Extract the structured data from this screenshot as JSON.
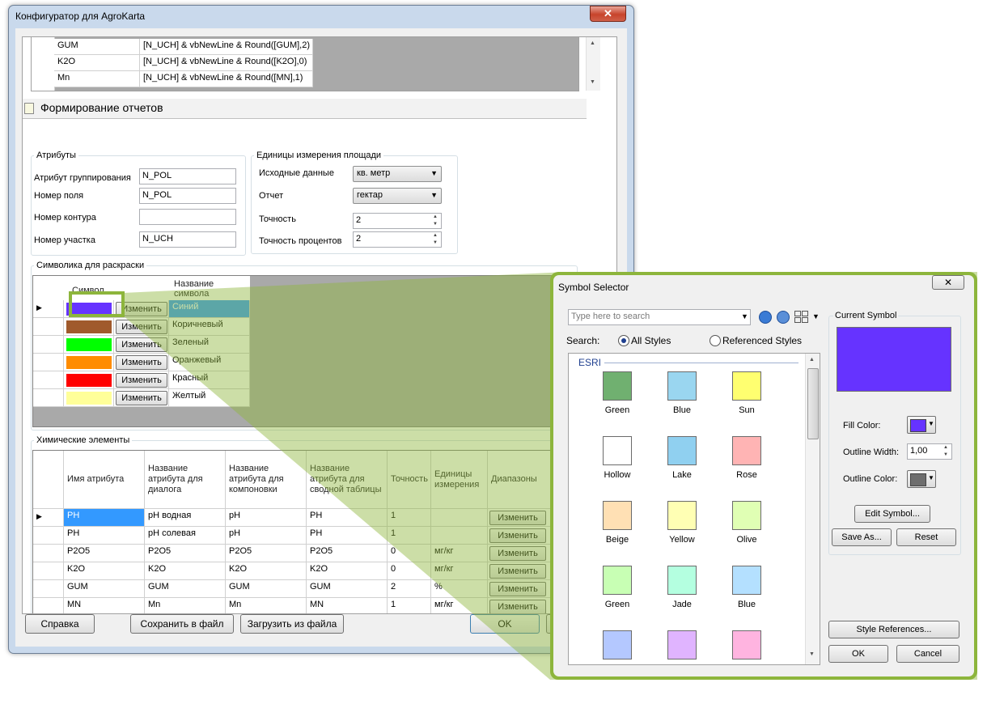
{
  "main_window": {
    "title": "Конфигуратор для AgroKarta",
    "close_glyph": "✕",
    "top_table": [
      {
        "name": "GUM",
        "expr": "[N_UCH] &  vbNewLine  &  Round([GUM],2)"
      },
      {
        "name": "K2O",
        "expr": "[N_UCH] &  vbNewLine  &  Round([K2O],0)"
      },
      {
        "name": "Mn",
        "expr": "[N_UCH] &  vbNewLine  &  Round([MN],1)"
      }
    ],
    "section_title": "Формирование отчетов",
    "attributes": {
      "group_label": "Атрибуты",
      "fields": [
        {
          "label": "Атрибут группирования",
          "value": "N_POL"
        },
        {
          "label": "Номер поля",
          "value": "N_POL"
        },
        {
          "label": "Номер контура",
          "value": ""
        },
        {
          "label": "Номер участка",
          "value": "N_UCH"
        }
      ]
    },
    "units": {
      "group_label": "Единицы измерения площади",
      "source_label": "Исходные данные",
      "source_value": "кв. метр",
      "report_label": "Отчет",
      "report_value": "гектар",
      "precision_label": "Точность",
      "precision_value": "2",
      "percent_label": "Точность процентов",
      "percent_value": "2"
    },
    "symbols": {
      "group_label": "Символика для раскраски",
      "col_symbol": "Символ",
      "col_name": "Название символа",
      "change_label": "Изменить",
      "rows": [
        {
          "color": "#6633ff",
          "name": "Синий"
        },
        {
          "color": "#a05a2c",
          "name": "Коричневый"
        },
        {
          "color": "#00ff00",
          "name": "Зеленый"
        },
        {
          "color": "#ff8c00",
          "name": "Оранжевый"
        },
        {
          "color": "#ff0000",
          "name": "Красный"
        },
        {
          "color": "#ffff99",
          "name": "Желтый"
        }
      ]
    },
    "chem": {
      "group_label": "Химические элементы",
      "headers": [
        "Имя атрибута",
        "Название атрибута для диалога",
        "Название атрибута для компоновки",
        "Название атрибута для сводной таблицы",
        "Точность",
        "Единицы измерения",
        "Диапазоны"
      ],
      "change_label": "Изменить",
      "rows": [
        [
          "PH",
          "pH водная",
          "pH",
          "PH",
          "1",
          ""
        ],
        [
          "PH",
          "pH солевая",
          "pH",
          "PH",
          "1",
          ""
        ],
        [
          "P2O5",
          "P2O5",
          "P2O5",
          "P2O5",
          "0",
          "мг/кг"
        ],
        [
          "K2O",
          "K2O",
          "K2O",
          "K2O",
          "0",
          "мг/кг"
        ],
        [
          "GUM",
          "GUM",
          "GUM",
          "GUM",
          "2",
          "%"
        ],
        [
          "MN",
          "Mn",
          "Mn",
          "MN",
          "1",
          "мг/кг"
        ]
      ]
    },
    "buttons": {
      "help": "Справка",
      "save": "Сохранить в файл",
      "load": "Загрузить из файла",
      "ok": "OK"
    }
  },
  "symbol_selector": {
    "title": "Symbol Selector",
    "close_glyph": "✕",
    "search_placeholder": "Type here to search",
    "search_label": "Search:",
    "all_styles": "All Styles",
    "referenced_styles": "Referenced Styles",
    "category": "ESRI",
    "symbols": [
      {
        "name": "Green",
        "color": "#70b070"
      },
      {
        "name": "Blue",
        "color": "#9ad6f0"
      },
      {
        "name": "Sun",
        "color": "#ffff70"
      },
      {
        "name": "Hollow",
        "color": "#ffffff"
      },
      {
        "name": "Lake",
        "color": "#90d0f0"
      },
      {
        "name": "Rose",
        "color": "#ffb4b4"
      },
      {
        "name": "Beige",
        "color": "#ffe0b4"
      },
      {
        "name": "Yellow",
        "color": "#ffffb4"
      },
      {
        "name": "Olive",
        "color": "#e0ffb4"
      },
      {
        "name": "Green",
        "color": "#c8ffb4"
      },
      {
        "name": "Jade",
        "color": "#b4ffe0"
      },
      {
        "name": "Blue",
        "color": "#b4e0ff"
      },
      {
        "name": "",
        "color": "#b4c8ff"
      },
      {
        "name": "",
        "color": "#e0b4ff"
      },
      {
        "name": "",
        "color": "#ffb4e0"
      }
    ],
    "current_symbol_label": "Current Symbol",
    "current_color": "#6633ff",
    "fill_color_label": "Fill Color:",
    "fill_color": "#6633ff",
    "outline_width_label": "Outline Width:",
    "outline_width": "1,00",
    "outline_color_label": "Outline Color:",
    "outline_color": "#6e6e6e",
    "edit_symbol": "Edit Symbol...",
    "save_as": "Save As...",
    "reset": "Reset",
    "style_references": "Style References...",
    "ok": "OK",
    "cancel": "Cancel"
  }
}
